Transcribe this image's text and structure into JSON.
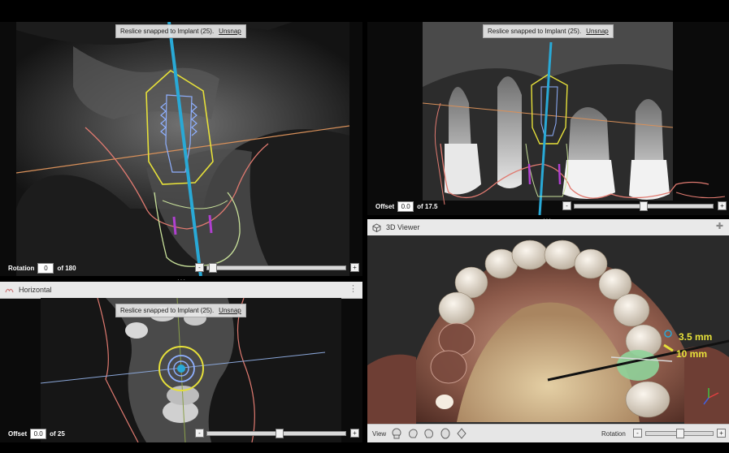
{
  "snap_banner": {
    "text": "Reslice snapped to Implant (25).",
    "unsnap_label": "Unsnap"
  },
  "pane_top_left": {
    "rotation_label": "Rotation",
    "rotation_value": "0",
    "rotation_of": "of 180"
  },
  "pane_top_right": {
    "offset_label": "Offset",
    "offset_value": "0.0",
    "offset_of": "of 17.5"
  },
  "pane_horizontal": {
    "title": "Horizontal",
    "offset_label": "Offset",
    "offset_value": "0.0",
    "offset_of": "of 25"
  },
  "pane_3d": {
    "title": "3D Viewer",
    "implant_diameter": "3.5 mm",
    "implant_length": "10 mm",
    "view_label": "View",
    "rotation_label": "Rotation",
    "view_icons": [
      "skull-front-icon",
      "skull-side-icon",
      "skull-back-icon",
      "skull-top-icon",
      "skull-bottom-icon"
    ]
  },
  "colors": {
    "implant_axis": "#29a9d6",
    "implant_outline": "#8fb0ff",
    "safety_zone": "#e6e03a",
    "nerve_line": "#e07a70",
    "reference_line": "#d8905a",
    "root_outline": "#c8e09a",
    "marker": "#b040d0"
  }
}
